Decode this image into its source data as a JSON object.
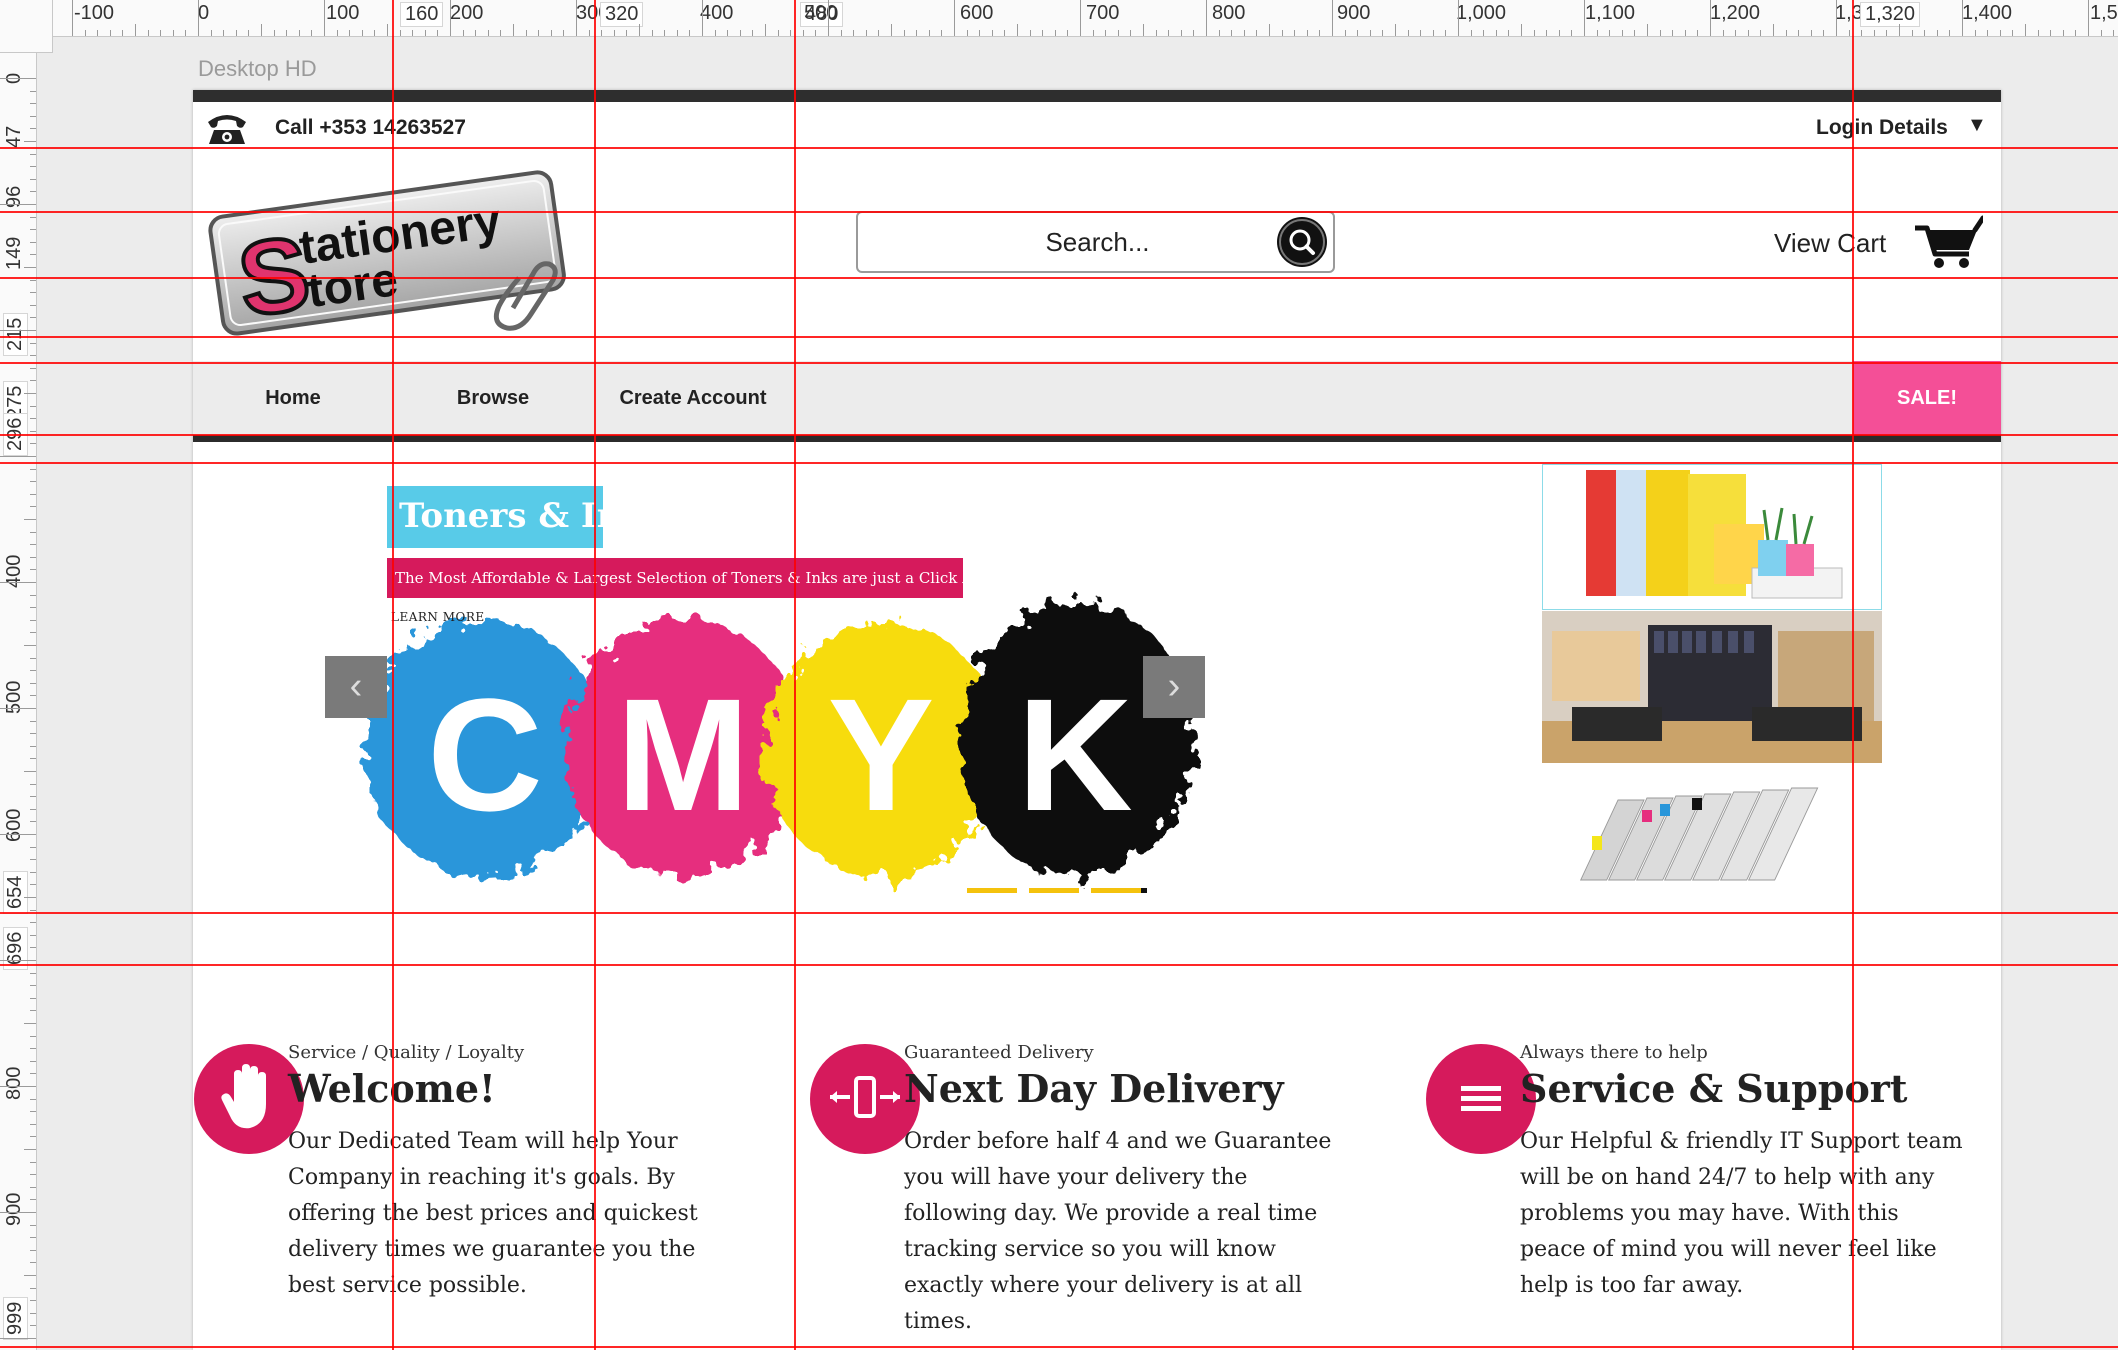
{
  "editor": {
    "artboard_name": "Desktop HD",
    "ruler_top_labels": [
      "-100",
      "0",
      "100",
      "160",
      "200",
      "300",
      "320",
      "400",
      "480",
      "500",
      "600",
      "700",
      "800",
      "900",
      "1,000",
      "1,100",
      "1,200",
      "1,300",
      "1,320",
      "1,400",
      "1,5"
    ],
    "ruler_left_labels": [
      "0",
      "47",
      "96",
      "149",
      "215",
      "275",
      "296",
      "400",
      "500",
      "600",
      "654",
      "696",
      "800",
      "900",
      "999"
    ]
  },
  "header": {
    "phone_icon": "telephone-icon",
    "phone_text": "Call +353 14263527",
    "login_label": "Login Details",
    "login_arrow": "▼"
  },
  "logo": {
    "line1": "tationery",
    "line2": "tore",
    "initial": "S"
  },
  "search": {
    "placeholder": "Search...",
    "icon": "search-icon"
  },
  "cart": {
    "label": "View Cart",
    "icon": "shopping-cart-icon"
  },
  "nav": {
    "items": [
      {
        "label": "Home"
      },
      {
        "label": "Browse"
      },
      {
        "label": "Create Account"
      }
    ],
    "sale_label": "SALE!"
  },
  "hero": {
    "title": "Toners & Ink",
    "subtitle": "The Most Affordable & Largest Selection of Toners & Inks are just a Click Away",
    "link": "LEARN MORE",
    "letters": [
      "C",
      "M",
      "Y",
      "K"
    ],
    "prev_glyph": "‹",
    "next_glyph": "›",
    "slide_count": 3
  },
  "side_images": [
    "office-supplies-image",
    "office-room-image",
    "ink-cartridges-image"
  ],
  "features": [
    {
      "icon": "hand-icon",
      "kicker": "Service / Quality / Loyalty",
      "title": "Welcome!",
      "body": "Our Dedicated Team will help Your Company in reaching it's goals. By offering the best prices and quickest delivery times we guarantee you the best service possible."
    },
    {
      "icon": "mobile-arrows-icon",
      "kicker": "Guaranteed Delivery",
      "title": "Next Day Delivery",
      "body": "Order before half 4 and we Guarantee you will have your delivery the following day. We provide a real time tracking service so you will know exactly where your delivery is at all times."
    },
    {
      "icon": "menu-lines-icon",
      "kicker": "Always there to help",
      "title": "Service & Support",
      "body": "Our Helpful & friendly IT Support team will be on hand 24/7 to help with any problems you may have. With this peace of mind you will never feel like help is too far away."
    }
  ],
  "colors": {
    "accent_pink": "#d61a5c",
    "sale_pink": "#f44f97",
    "hero_cyan": "#58cbe8",
    "dots_yellow": "#f4c20d",
    "guide_red": "#ff0000"
  }
}
